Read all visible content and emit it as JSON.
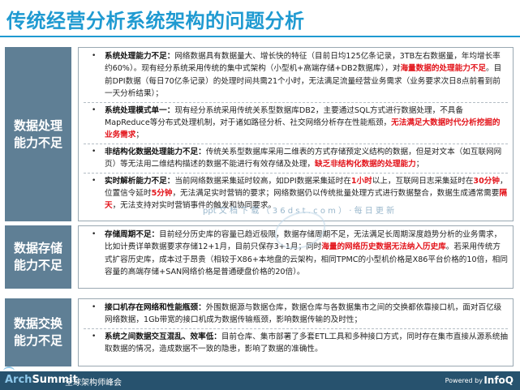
{
  "title": "传统经营分析系统架构的问题分析",
  "sections": [
    {
      "label": "数据处理能力不足",
      "items": [
        {
          "head": "系统处理能力不足：",
          "parts": [
            {
              "t": "网络数据具有数据量大、增长快的特征（目前日均125亿条记录，3TB左右数据量，年均增长率约60%）。现有经分系统采用传统的集中式架构（小型机+高端存储+DB2数据库），对",
              "r": false
            },
            {
              "t": "海量数据的处理能力不足",
              "r": true
            },
            {
              "t": "。目前DPI数据（每日70亿条记录）的处理时间共需21个小时，无法满足流量经营业务需求（业务要求次日8点前看到前一天分析结果）；",
              "r": false
            }
          ]
        },
        {
          "head": "系统处理模式单一：",
          "parts": [
            {
              "t": "现有经分系统采用传统关系型数据库DB2，主要通过SQL方式进行数据处理，不具备MapReduce等分布式处理机制，对于诸如路径分析、社交网络分析存在性能瓶颈，",
              "r": false
            },
            {
              "t": "无法满足大数据时代分析挖掘的业务需求",
              "r": true
            },
            {
              "t": "；",
              "r": false
            }
          ]
        },
        {
          "head": "非结构化数据处理能力不足：",
          "parts": [
            {
              "t": "传统关系型数据库采用二维表的方式存储预定义结构的数据，但是对文本（如互联网网页）等无法用二维结构描述的数据不能进行有效存储及处理，",
              "r": false
            },
            {
              "t": "缺乏非结构化数据的处理能力",
              "r": true
            },
            {
              "t": "；",
              "r": false
            }
          ]
        },
        {
          "head": "实时解析能力不足：",
          "parts": [
            {
              "t": "当前网络数据采集延时较高，如DPI数据采集延时在",
              "r": false
            },
            {
              "t": "1小时",
              "r": true
            },
            {
              "t": "以上，互联网日志采集延时在",
              "r": false
            },
            {
              "t": "30分钟",
              "r": true
            },
            {
              "t": "，位置信令延时",
              "r": false
            },
            {
              "t": "5分钟",
              "r": true
            },
            {
              "t": "，无法满足实时营销的要求；网络数据仍以传统批量处理方式进行数据整合，数据生成通常需要",
              "r": false
            },
            {
              "t": "隔天",
              "r": true
            },
            {
              "t": "，无法支持对实时营销事件的触发和协同要求。",
              "r": false
            }
          ]
        }
      ]
    },
    {
      "label": "数据存储能力不足",
      "items": [
        {
          "head": "存储周期不足：",
          "parts": [
            {
              "t": "目前经分历史库的容量已趋近极限，数据存储周期不足，无法满足长周期深度趋势分析的业务需求，比如计费详单数据要求存储12+1月，目前只保存3+1月；同时",
              "r": false
            },
            {
              "t": "海量的网络历史数据无法纳入历史库",
              "r": true
            },
            {
              "t": "。若采用传统方式扩容历史库，成本过于昂贵（相较于X86+本地盘的云架构，相同TPMC的小型机价格是X86平台价格的10倍，相同容量的高端存储+SAN网络价格是普通硬盘价格的20倍）。",
              "r": false
            }
          ]
        }
      ]
    },
    {
      "label": "数据交换能力不足",
      "items": [
        {
          "head": "接口机存在网络和性能瓶颈：",
          "parts": [
            {
              "t": "外围数据源与数据仓库，数据仓库与各数据集市之间的交换都依靠接口机，面对百亿级网络数据，1Gb带宽的接口机成为数据传输瓶颈，影响数据传输的及时性；",
              "r": false
            }
          ]
        },
        {
          "head": "系统之间数据交互混乱、效率低：",
          "parts": [
            {
              "t": "目前仓库、集市部署了多套ETL工具和多种接口方式，同时存在集市直接从源系统抽取数据的情况，造成数据不一致的隐患，影响了数据的准确性。",
              "r": false
            }
          ]
        }
      ]
    }
  ],
  "watermark": "ppt  文  档  下  载  （  3  6  d  s  t  .  c  o  m  ）  ·  每  日  更  新",
  "footer": {
    "brand_main": "Arch",
    "brand_sub": "Summit",
    "tagline": "全球架构师峰会",
    "powered": "Powered by",
    "infoq": "InfoQ"
  },
  "colors": {
    "accent": "#1f9ad1",
    "label_bg": "#5f7f95",
    "highlight": "#e3141b",
    "footer_bg": "#27526e"
  }
}
